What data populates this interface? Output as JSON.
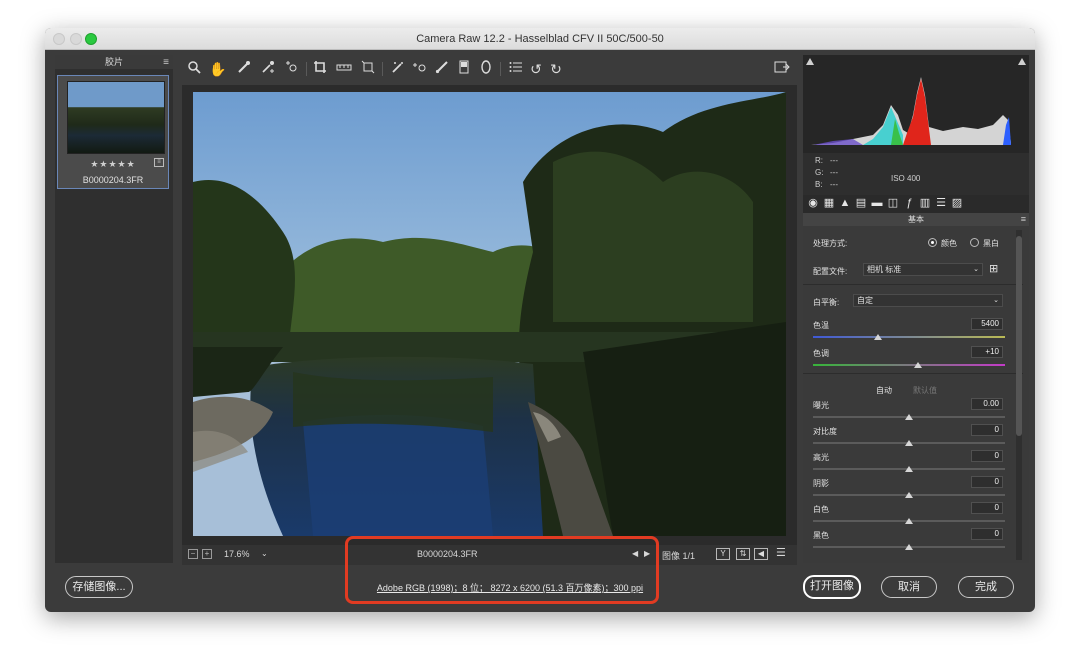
{
  "window": {
    "title": "Camera Raw 12.2 -  Hasselblad CFV II 50C/500-50"
  },
  "filmstrip": {
    "header": "胶片",
    "stars": "★★★★★",
    "filename": "B0000204.3FR"
  },
  "toolbar": {
    "tools": [
      "zoom-icon",
      "hand-icon",
      "white-balance-icon",
      "color-sampler-icon",
      "targeted-adjustment-icon",
      "crop-icon",
      "straighten-icon",
      "transform-icon",
      "spot-removal-icon",
      "red-eye-icon",
      "adjustment-brush-icon",
      "graduated-filter-icon",
      "radial-filter-icon",
      "presets-list-icon",
      "rotate-left-icon",
      "rotate-right-icon"
    ],
    "fullscreen_icon": "fullscreen-icon"
  },
  "preview_bar": {
    "zoom": "17.6%",
    "filename": "B0000204.3FR",
    "image_count": "图像 1/1"
  },
  "footer": {
    "save_label": "存储图像...",
    "workflow_info": "Adobe RGB (1998)；8 位；  8272 x 6200 (51.3 百万像素)；300 ppi",
    "open_label": "打开图像",
    "cancel_label": "取消",
    "done_label": "完成",
    "highlight_color": "#e13b22"
  },
  "histogram": {
    "r": "R:",
    "g": "G:",
    "b": "B:",
    "dash": "---",
    "iso": "ISO 400"
  },
  "panel": {
    "title": "基本",
    "treatment_label": "处理方式:",
    "treatment_color": "颜色",
    "treatment_bw": "黑白",
    "profile_label": "配置文件:",
    "profile_value": "相机 标准",
    "wb_label": "白平衡:",
    "wb_value": "自定",
    "temp_label": "色温",
    "temp_value": "5400",
    "tint_label": "色调",
    "tint_value": "+10",
    "auto_label": "自动",
    "default_label": "默认值",
    "exposure_label": "曝光",
    "exposure_value": "0.00",
    "contrast_label": "对比度",
    "contrast_value": "0",
    "highlights_label": "高光",
    "highlights_value": "0",
    "shadows_label": "阴影",
    "shadows_value": "0",
    "whites_label": "白色",
    "whites_value": "0",
    "blacks_label": "黑色",
    "blacks_value": "0"
  }
}
